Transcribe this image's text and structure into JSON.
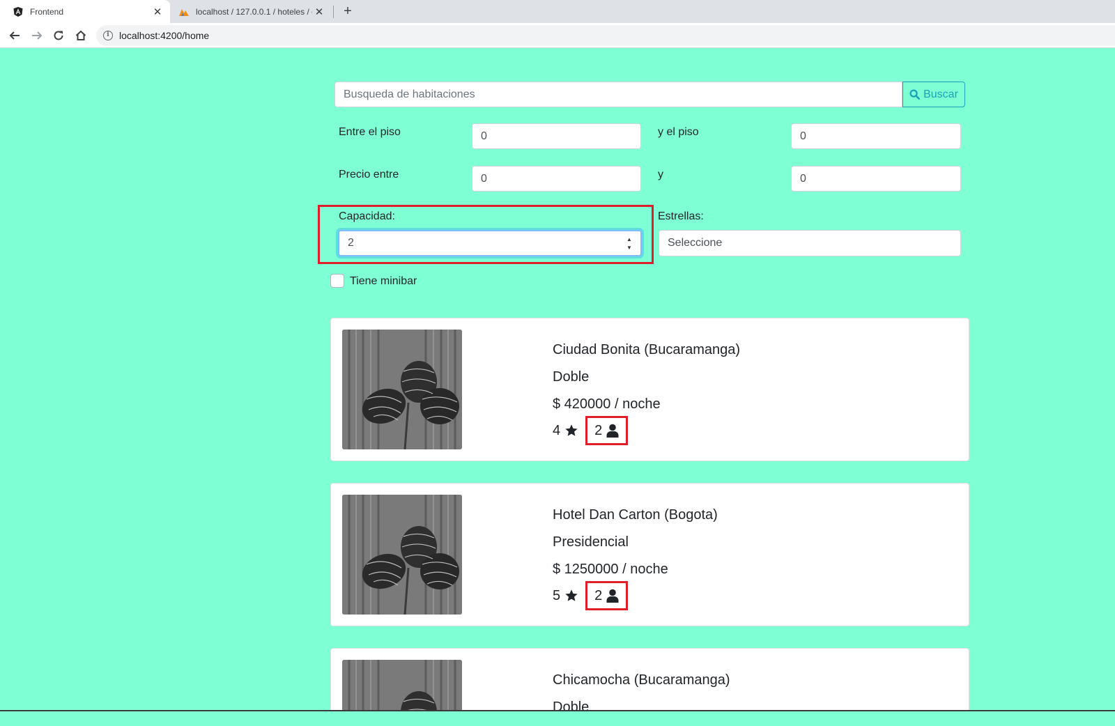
{
  "browser": {
    "tabs": [
      {
        "title": "Frontend",
        "active": true
      },
      {
        "title": "localhost / 127.0.0.1 / hoteles / c",
        "active": false
      }
    ],
    "url": "localhost:4200/home"
  },
  "search": {
    "placeholder": "Busqueda de habitaciones",
    "button_label": "Buscar"
  },
  "filters": {
    "floor_from_label": "Entre el piso",
    "floor_from_value": "0",
    "floor_to_label": "y el piso",
    "floor_to_value": "0",
    "price_from_label": "Precio entre",
    "price_from_value": "0",
    "price_to_label": "y",
    "price_to_value": "0",
    "capacity_label": "Capacidad:",
    "capacity_value": "2",
    "stars_label": "Estrellas:",
    "stars_value": "Seleccione",
    "minibar_label": "Tiene minibar"
  },
  "rooms": [
    {
      "hotel": "Ciudad Bonita (Bucaramanga)",
      "type": "Doble",
      "price": "$ 420000 / noche",
      "stars": "4",
      "capacity": "2"
    },
    {
      "hotel": "Hotel Dan Carton (Bogota)",
      "type": "Presidencial",
      "price": "$ 1250000 / noche",
      "stars": "5",
      "capacity": "2"
    },
    {
      "hotel": "Chicamocha (Bucaramanga)",
      "type": "Doble"
    }
  ],
  "colors": {
    "page_background": "#7fffd4",
    "highlight": "#e01e2b",
    "info_accent": "#17a2b8"
  }
}
